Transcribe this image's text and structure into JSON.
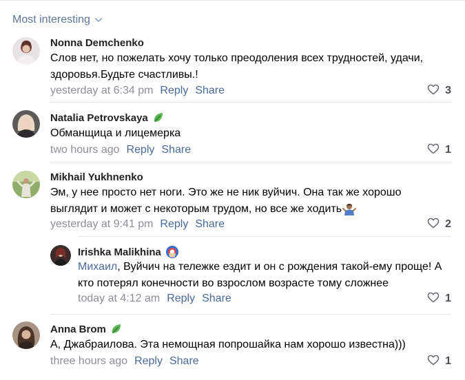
{
  "sort": {
    "label": "Most interesting"
  },
  "comments": [
    {
      "author": "Nonna Demchenko",
      "text_line1": "Слов нет, но пожелать хочу только преодоления всех трудностей, удачи,",
      "text_line2": "здоровья.Будьте счастливы.!",
      "time": "yesterday at 6:34 pm",
      "reply": "Reply",
      "share": "Share",
      "likes": "3"
    },
    {
      "author": "Natalia Petrovskaya",
      "badge": "leaf-badge-icon",
      "text_line1": "Обманщица и лицемерка",
      "time": "two hours ago",
      "reply": "Reply",
      "share": "Share",
      "likes": "1"
    },
    {
      "author": "Mikhail Yukhnenko",
      "text_line1": "Эм, у нее просто нет ноги. Это же не ник вуйчич. Она так же хорошо",
      "text_line2": "выглядит и может с некоторым трудом, но все же ходить",
      "emoji": "person-shrugging-emoji",
      "time": "yesterday at 9:41 pm",
      "reply": "Reply",
      "share": "Share",
      "likes": "2"
    },
    {
      "author": "Irishka Malikhina",
      "badge": "shield-badge-icon",
      "mention": "Михаил",
      "text_line1_rest": ", Вуйчич на тележке ездит и он с рождения такой-ему проще! А",
      "text_line2": "кто потерял конечности во взрослом возрасте тому сложнее",
      "time": "today at 4:12 am",
      "reply": "Reply",
      "share": "Share",
      "likes": "1"
    },
    {
      "author": "Anna Brom",
      "badge": "leaf-badge-icon",
      "text_line1": "А, Джабраилова. Эта немощная попрошайка нам хорошо известна)))",
      "time": "three hours ago",
      "reply": "Reply",
      "share": "Share",
      "likes": "1"
    }
  ],
  "colors": {
    "link": "#4a6a95",
    "muted": "#8b8f96",
    "separator": "#e3e5e8",
    "sort_label": "#5e7493"
  }
}
